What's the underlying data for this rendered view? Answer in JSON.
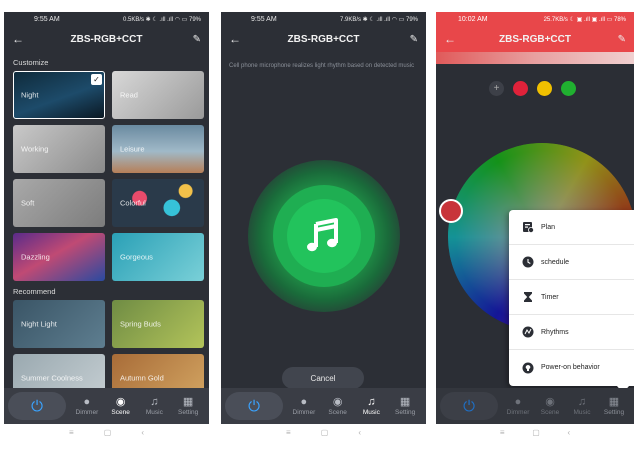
{
  "phone1": {
    "status": {
      "time": "9:55 AM",
      "right": "0.5KB/s ✱ ☾ .ıll .ıll ◠ ▭ 79%"
    },
    "header": {
      "title": "ZBS-RGB+CCT"
    },
    "customize_label": "Customize",
    "customize": [
      {
        "label": "Night",
        "selected": true
      },
      {
        "label": "Read"
      },
      {
        "label": "Working"
      },
      {
        "label": "Leisure"
      },
      {
        "label": "Soft"
      },
      {
        "label": "Colorful"
      },
      {
        "label": "Dazzling"
      },
      {
        "label": "Gorgeous"
      }
    ],
    "recommend_label": "Recommend",
    "recommend": [
      {
        "label": "Night Light"
      },
      {
        "label": "Spring Buds"
      },
      {
        "label": "Summer Coolness"
      },
      {
        "label": "Autumn Gold"
      }
    ],
    "nav": [
      "Dimmer",
      "Scene",
      "Music",
      "Setting"
    ],
    "active_nav": "Scene"
  },
  "phone2": {
    "status": {
      "time": "9:55 AM",
      "right": "7.9KB/s ✱ ☾ .ıll .ıll ◠ ▭ 79%"
    },
    "header": {
      "title": "ZBS-RGB+CCT"
    },
    "description": "Cell phone microphone realizes light rhythm based on detected music",
    "cancel": "Cancel",
    "nav": [
      "Dimmer",
      "Scene",
      "Music",
      "Setting"
    ],
    "active_nav": "Music"
  },
  "phone3": {
    "status": {
      "time": "10:02 AM",
      "right": "25.7KB/s ☾ ▣ .ıll ▣ .ıll ▭ 78%"
    },
    "header": {
      "title": "ZBS-RGB+CCT"
    },
    "swatch_colors": [
      "#e0223a",
      "#f0c000",
      "#20b030"
    ],
    "menu": [
      {
        "label": "Plan",
        "icon": "plan-icon"
      },
      {
        "label": "schedule",
        "icon": "clock-icon"
      },
      {
        "label": "Timer",
        "icon": "hourglass-icon"
      },
      {
        "label": "Rhythms",
        "icon": "rhythm-icon"
      },
      {
        "label": "Power-on behavior",
        "icon": "power-behavior-icon"
      }
    ],
    "nav": [
      "Dimmer",
      "Scene",
      "Music",
      "Setting"
    ]
  },
  "sysnav": {
    "menu": "≡",
    "home": "▢",
    "back": "‹"
  }
}
